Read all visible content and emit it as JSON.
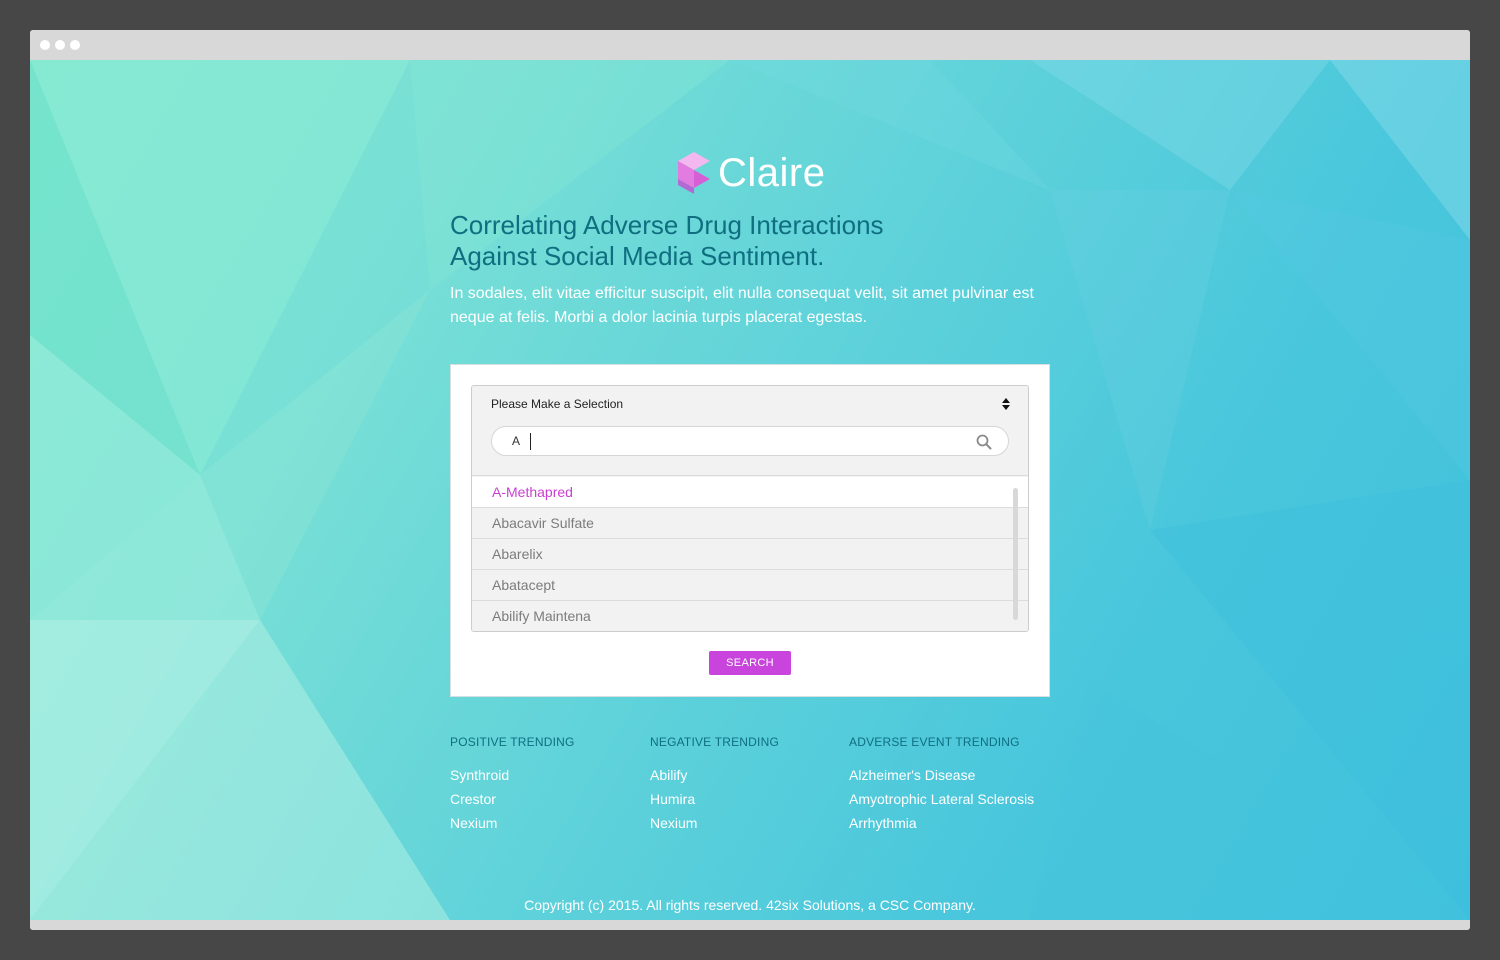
{
  "brand": {
    "name": "Claire"
  },
  "hero": {
    "headline_line1": "Correlating Adverse Drug Interactions",
    "headline_line2": "Against Social Media Sentiment.",
    "intro": "In sodales, elit vitae efficitur suscipit, elit nulla consequat velit, sit amet pulvinar est neque at felis. Morbi a dolor lacinia turpis placerat egestas."
  },
  "selector": {
    "label": "Please Make a Selection",
    "search_value": "A",
    "options": [
      "A-Methapred",
      "Abacavir Sulfate",
      "Abarelix",
      "Abatacept",
      "Abilify Maintena"
    ],
    "active_option": "A-Methapred"
  },
  "search_button": {
    "label": "SEARCH"
  },
  "trending": [
    {
      "title": "POSITIVE TRENDING",
      "items": [
        "Synthroid",
        "Crestor",
        "Nexium"
      ]
    },
    {
      "title": "NEGATIVE TRENDING",
      "items": [
        "Abilify",
        "Humira",
        "Nexium"
      ]
    },
    {
      "title": "ADVERSE EVENT TRENDING",
      "items": [
        "Alzheimer's Disease",
        "Amyotrophic Lateral Sclerosis",
        "Arrhythmia"
      ]
    }
  ],
  "footer": {
    "copyright": "Copyright (c) 2015. All rights reserved. 42six Solutions, a CSC Company."
  },
  "colors": {
    "accent": "#c944dc",
    "heading": "#0f6f80",
    "background_start": "#7fe6cf",
    "background_end": "#40c1dd"
  },
  "icons": [
    "claire-logo-icon",
    "select-arrows-icon",
    "search-icon"
  ]
}
